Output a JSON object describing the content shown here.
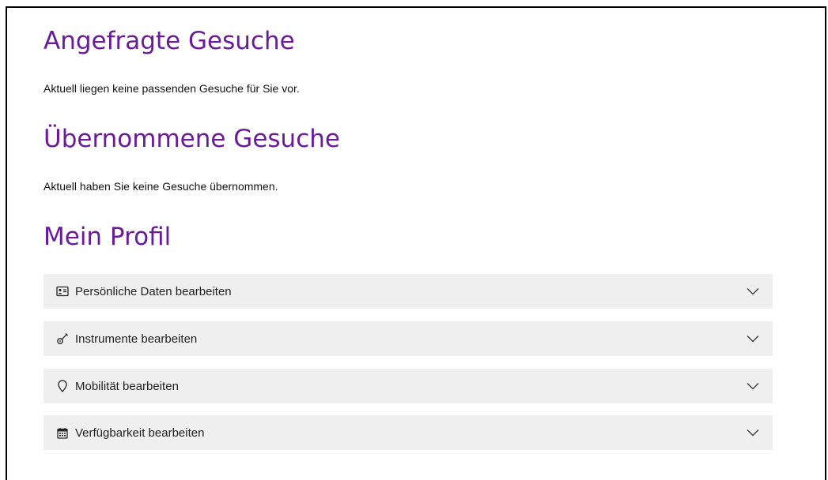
{
  "sections": {
    "requested": {
      "title": "Angefragte Gesuche",
      "text": "Aktuell liegen keine passenden Gesuche für Sie vor."
    },
    "taken": {
      "title": "Übernommene Gesuche",
      "text": "Aktuell haben Sie keine Gesuche übernommen."
    },
    "profile": {
      "title": "Mein Profil",
      "items": [
        {
          "label": "Persönliche Daten bearbeiten",
          "icon": "id-card-icon"
        },
        {
          "label": "Instrumente bearbeiten",
          "icon": "guitar-icon"
        },
        {
          "label": "Mobilität bearbeiten",
          "icon": "map-pin-icon"
        },
        {
          "label": "Verfügbarkeit bearbeiten",
          "icon": "calendar-icon"
        }
      ]
    }
  },
  "colors": {
    "heading": "#6a1b9a",
    "accordion_bg": "#efefef"
  }
}
